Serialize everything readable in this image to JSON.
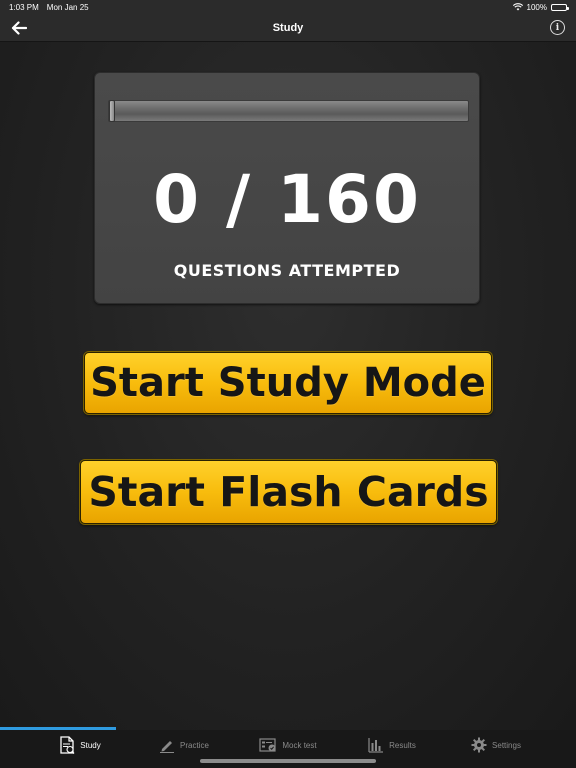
{
  "status_bar": {
    "time": "1:03 PM",
    "date": "Mon Jan 25",
    "battery": "100%",
    "icons": [
      "wifi-icon",
      "battery-icon"
    ]
  },
  "nav": {
    "title": "Study",
    "back_icon": "back-arrow-icon",
    "info_icon": "info-icon",
    "info_glyph": "i"
  },
  "progress": {
    "attempted": 0,
    "total": 160,
    "count_text": "0 / 160",
    "caption": "QUESTIONS ATTEMPTED",
    "fraction": 0
  },
  "buttons": {
    "study_mode": "Start Study Mode",
    "flash_cards": "Start Flash Cards"
  },
  "tabs": [
    {
      "label": "Study",
      "icon": "study-document-icon",
      "active": true
    },
    {
      "label": "Practice",
      "icon": "pencil-icon",
      "active": false
    },
    {
      "label": "Mock test",
      "icon": "mock-test-icon",
      "active": false
    },
    {
      "label": "Results",
      "icon": "bar-chart-icon",
      "active": false
    },
    {
      "label": "Settings",
      "icon": "gear-icon",
      "active": false
    }
  ],
  "colors": {
    "accent": "#2f9be0",
    "button": "#f8bc0d",
    "background": "#1f1f1f"
  }
}
